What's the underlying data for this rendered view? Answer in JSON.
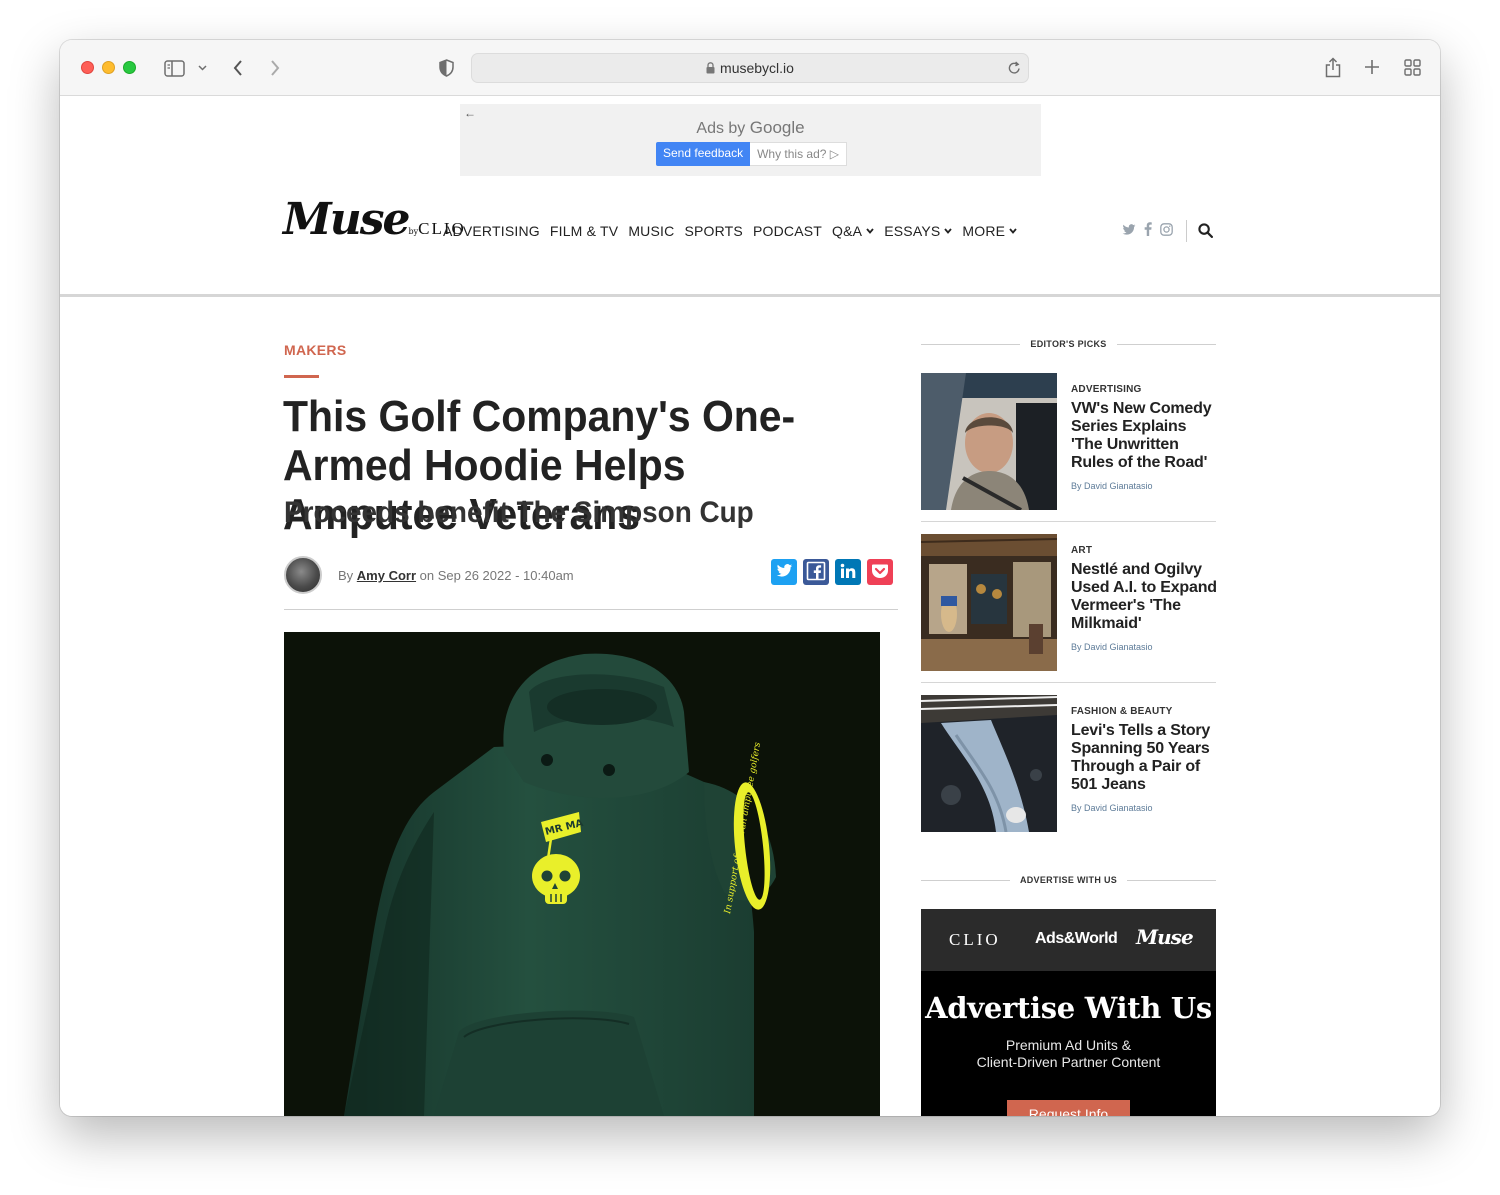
{
  "browser": {
    "url": "musebycl.io"
  },
  "ad": {
    "back_arrow": "←",
    "title_prefix": "Ads by",
    "title_brand": "Google",
    "send_feedback": "Send feedback",
    "why_this_ad": "Why this ad? ▷"
  },
  "header": {
    "logo_main": "Muse",
    "logo_by": "by",
    "logo_clio": "CLIO",
    "nav": [
      {
        "label": "ADVERTISING",
        "has_dropdown": false
      },
      {
        "label": "FILM & TV",
        "has_dropdown": false
      },
      {
        "label": "MUSIC",
        "has_dropdown": false
      },
      {
        "label": "SPORTS",
        "has_dropdown": false
      },
      {
        "label": "PODCAST",
        "has_dropdown": false
      },
      {
        "label": "Q&A",
        "has_dropdown": true
      },
      {
        "label": "ESSAYS",
        "has_dropdown": true
      },
      {
        "label": "MORE",
        "has_dropdown": true
      }
    ],
    "social_icons": [
      "twitter-icon",
      "facebook-icon",
      "instagram-icon"
    ]
  },
  "article": {
    "category": "MAKERS",
    "headline": "This Golf Company's One-Armed Hoodie Helps Amputee Veterans",
    "subhead": "Proceeds benefit The Simpson Cup",
    "byline_prefix": "By",
    "author": "Amy Corr",
    "byline_date": "on Sep 26 2022 - 10:40am",
    "share": [
      {
        "name": "twitter",
        "color": "#1da1f2"
      },
      {
        "name": "facebook",
        "color": "#3b5998"
      },
      {
        "name": "linkedin",
        "color": "#0077b5"
      },
      {
        "name": "pocket",
        "color": "#ef4056"
      }
    ],
    "hero": {
      "flag_text": "MR MA",
      "sleeve_text": "In support of veteran amputee golfers",
      "hoodie_color": "#1f4437",
      "accent_color": "#e9ef2a"
    }
  },
  "sidebar": {
    "editors_picks_label": "EDITOR'S PICKS",
    "picks": [
      {
        "category": "ADVERTISING",
        "title": "VW's New Comedy Series Explains 'The Unwritten Rules of the Road'",
        "byline": "By David Gianatasio"
      },
      {
        "category": "ART",
        "title": "Nestlé and Ogilvy Used A.I. to Expand Vermeer's 'The Milkmaid'",
        "byline": "By David Gianatasio"
      },
      {
        "category": "FASHION & BEAUTY",
        "title": "Levi's Tells a Story Spanning 50 Years Through a Pair of 501 Jeans",
        "byline": "By David Gianatasio"
      }
    ],
    "advertise_label": "ADVERTISE WITH US",
    "advertise": {
      "brand_clio": "CLIO",
      "brand_adsworld": "Ads&World",
      "brand_muse": "Muse",
      "title": "Advertise With Us",
      "sub_line1": "Premium Ad Units &",
      "sub_line2": "Client-Driven Partner Content",
      "button": "Request Info"
    }
  },
  "colors": {
    "accent": "#d0664f",
    "link_blue": "#5d7b98"
  }
}
